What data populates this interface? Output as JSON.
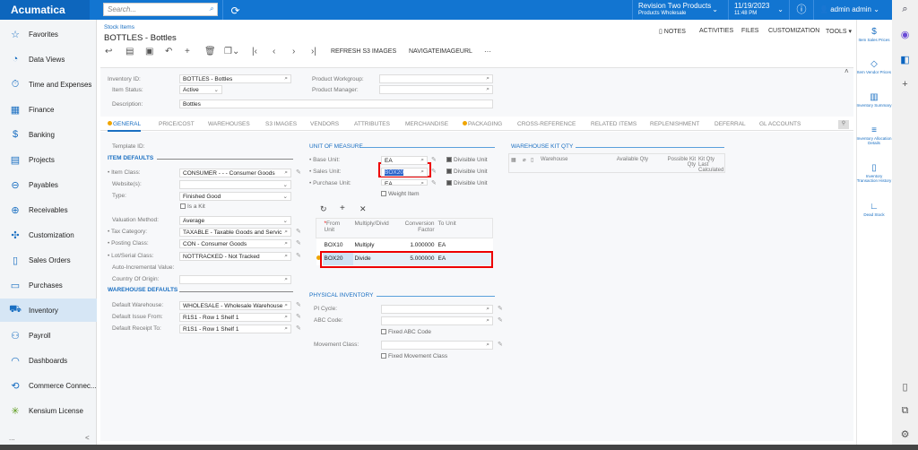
{
  "app": {
    "brand": "Acumatica",
    "search_placeholder": "Search...",
    "company": "Revision Two Products",
    "branch": "Products Wholesale",
    "date": "11/19/2023",
    "time": "11:48 PM",
    "user": "admin admin"
  },
  "sidebar": {
    "items": [
      {
        "label": "Favorites",
        "icon": "star-icon"
      },
      {
        "label": "Data Views",
        "icon": "pie-chart-icon"
      },
      {
        "label": "Time and Expenses",
        "icon": "stopwatch-icon"
      },
      {
        "label": "Finance",
        "icon": "calculator-icon"
      },
      {
        "label": "Banking",
        "icon": "dollar-icon"
      },
      {
        "label": "Projects",
        "icon": "clipboard-icon"
      },
      {
        "label": "Payables",
        "icon": "minus-circle-icon"
      },
      {
        "label": "Receivables",
        "icon": "plus-circle-icon"
      },
      {
        "label": "Customization",
        "icon": "puzzle-icon"
      },
      {
        "label": "Sales Orders",
        "icon": "document-icon"
      },
      {
        "label": "Purchases",
        "icon": "cart-icon"
      },
      {
        "label": "Inventory",
        "icon": "truck-icon",
        "active": true
      },
      {
        "label": "Payroll",
        "icon": "people-dollar-icon"
      },
      {
        "label": "Dashboards",
        "icon": "gauge-icon"
      },
      {
        "label": "Commerce Connec...",
        "icon": "sync-icon"
      },
      {
        "label": "Kensium License",
        "icon": "kensium-icon"
      }
    ],
    "more": "...",
    "collapse": "<"
  },
  "page": {
    "breadcrumb": "Stock Items",
    "title": "BOTTLES - Bottles",
    "actions": {
      "notes": "NOTES",
      "activities": "ACTIVITIES",
      "files": "FILES",
      "customization": "CUSTOMIZATION",
      "tools": "TOOLS"
    },
    "toolbar": {
      "refresh": "REFRESH S3 IMAGES",
      "navigate": "NAVIGATEIMAGEURL",
      "more": "···"
    }
  },
  "summary": {
    "inventory_id_label": "Inventory ID:",
    "inventory_id": "BOTTLES - Bottles",
    "item_status_label": "Item Status:",
    "item_status": "Active",
    "description_label": "Description:",
    "description": "Bottles",
    "workgroup_label": "Product Workgroup:",
    "manager_label": "Product Manager:"
  },
  "tabs": [
    "GENERAL",
    "PRICE/COST",
    "WAREHOUSES",
    "S3 IMAGES",
    "VENDORS",
    "ATTRIBUTES",
    "MERCHANDISE",
    "PACKAGING",
    "CROSS-REFERENCE",
    "RELATED ITEMS",
    "REPLENISHMENT",
    "DEFERRAL",
    "GL ACCOUNTS"
  ],
  "general": {
    "template_label": "Template ID:",
    "item_defaults": "ITEM DEFAULTS",
    "item_class_label": "Item Class:",
    "item_class": "CONSUMER -  - - Consumer Goods",
    "website_label": "Website(s):",
    "type_label": "Type:",
    "type": "Finished Good",
    "is_kit": "Is a Kit",
    "valuation_label": "Valuation Method:",
    "valuation": "Average",
    "tax_label": "Tax Category:",
    "tax": "TAXABLE - Taxable Goods and Servic",
    "posting_label": "Posting Class:",
    "posting": "CON - Consumer Goods",
    "lot_label": "Lot/Serial Class:",
    "lot": "NOTTRACKED - Not Tracked",
    "auto_label": "Auto-Incremental Value:",
    "country_label": "Country Of Origin:",
    "warehouse_defaults": "WAREHOUSE DEFAULTS",
    "dw_label": "Default Warehouse:",
    "dw": "WHOLESALE - Wholesale Warehouse",
    "di_label": "Default Issue From:",
    "di": "R1S1 - Row 1 Shelf 1",
    "dr_label": "Default Receipt To:",
    "dr": "R1S1 - Row 1 Shelf 1"
  },
  "uom": {
    "title": "UNIT OF MEASURE",
    "base_label": "Base Unit:",
    "base": "EA",
    "sales_label": "Sales Unit:",
    "sales": "BOX20",
    "purchase_label": "Purchase Unit:",
    "purchase": "EA",
    "divisible": "Divisible Unit",
    "weight_item": "Weight Item",
    "columns": [
      "From Unit",
      "Multiply/Divid",
      "Conversion Factor",
      "To Unit"
    ],
    "rows": [
      [
        "BOX10",
        "Multiply",
        "1.000000",
        "EA"
      ],
      [
        "BOX20",
        "Divide",
        "5.000000",
        "EA"
      ]
    ]
  },
  "kit": {
    "title": "WAREHOUSE KIT QTY",
    "columns": [
      "Warehouse",
      "Available Qty",
      "Possible Kit Qty",
      "Kit Qty Last Calculated"
    ]
  },
  "physical": {
    "title": "PHYSICAL INVENTORY",
    "pi_label": "PI Cycle:",
    "abc_label": "ABC Code:",
    "fixed_abc": "Fixed ABC Code",
    "movement_label": "Movement Class:",
    "fixed_movement": "Fixed Movement Class"
  },
  "right_panel": [
    {
      "label": "Item Sales Prices",
      "icon": "dollar-icon"
    },
    {
      "label": "Item Vendor Prices",
      "icon": "tag-icon"
    },
    {
      "label": "Inventory Summary",
      "icon": "building-icon"
    },
    {
      "label": "Inventory Allocation Details",
      "icon": "list-dollar-icon"
    },
    {
      "label": "Inventory Transaction History",
      "icon": "document-icon"
    },
    {
      "label": "Dead Stock",
      "icon": "chart-icon"
    }
  ],
  "colors": {
    "brand": "#1275d1",
    "highlight": "#e00000",
    "accent": "#1a6fc2"
  }
}
